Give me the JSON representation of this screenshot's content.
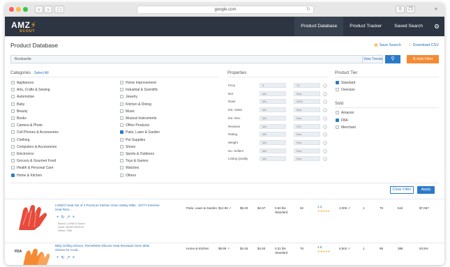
{
  "browser": {
    "url": "google.com"
  },
  "app": {
    "logo": "AMZ",
    "logo_sub": "SCOUT",
    "nav": [
      "Product Database",
      "Product Tracker",
      "Saved Search"
    ]
  },
  "page": {
    "title": "Product Database",
    "save_search": "Save Search",
    "download_csv": "Download CSV",
    "search_value": "Bookselle",
    "view_trends": "View Trends",
    "add_filter": "Add Filter"
  },
  "categories": {
    "title": "Categories",
    "select_all": "Select All",
    "col1": [
      {
        "label": "Appliances",
        "checked": false
      },
      {
        "label": "Arts, Crafts & Sewing",
        "checked": false
      },
      {
        "label": "Automotive",
        "checked": false
      },
      {
        "label": "Baby",
        "checked": false
      },
      {
        "label": "Beauty",
        "checked": false
      },
      {
        "label": "Books",
        "checked": false
      },
      {
        "label": "Camera & Photo",
        "checked": false
      },
      {
        "label": "Cell Phones & Accessories",
        "checked": false
      },
      {
        "label": "Clothing",
        "checked": false
      },
      {
        "label": "Computers & Accessories",
        "checked": false
      },
      {
        "label": "Electronics",
        "checked": false
      },
      {
        "label": "Grocery & Gourmet Food",
        "checked": false
      },
      {
        "label": "Health & Personal Care",
        "checked": false
      },
      {
        "label": "Home & Kitchen",
        "checked": true
      }
    ],
    "col2": [
      {
        "label": "Home Improvement",
        "checked": false
      },
      {
        "label": "Industrial & Scientific",
        "checked": false
      },
      {
        "label": "Jewelry",
        "checked": false
      },
      {
        "label": "Kitchen & Dining",
        "checked": false
      },
      {
        "label": "Music",
        "checked": false
      },
      {
        "label": "Musical Instruments",
        "checked": false
      },
      {
        "label": "Office Products",
        "checked": false
      },
      {
        "label": "Patio, Lawn & Garden",
        "checked": true
      },
      {
        "label": "Pet Supplies",
        "checked": false
      },
      {
        "label": "Shoes",
        "checked": false
      },
      {
        "label": "Sports & Outdoors",
        "checked": false
      },
      {
        "label": "Toys & Games",
        "checked": false
      },
      {
        "label": "Watches",
        "checked": false
      },
      {
        "label": "Others",
        "checked": false
      }
    ]
  },
  "properties": {
    "title": "Properties",
    "rows": [
      {
        "label": "Price",
        "min": "5",
        "max": "75"
      },
      {
        "label": "Net",
        "min": "Min",
        "max": "Max"
      },
      {
        "label": "Rank",
        "min": "Min",
        "max": "5000"
      },
      {
        "label": "Est. Sales",
        "min": "Min",
        "max": "Max"
      },
      {
        "label": "Est. Rev.",
        "min": "Min",
        "max": "Max"
      },
      {
        "label": "Reviews",
        "min": "Min",
        "max": "200"
      },
      {
        "label": "Rating",
        "min": "Min",
        "max": "Max"
      },
      {
        "label": "Weight",
        "min": "Min",
        "max": "Max"
      },
      {
        "label": "No. Sellers",
        "min": "Min",
        "max": "Max"
      },
      {
        "label": "Listing Quality",
        "min": "Min",
        "max": "Max"
      }
    ]
  },
  "product_tier": {
    "title": "Product Tier",
    "items": [
      {
        "label": "Standard",
        "checked": true
      },
      {
        "label": "Oversize",
        "checked": false
      }
    ]
  },
  "sold": {
    "title": "Sold",
    "items": [
      {
        "label": "Amazon",
        "checked": false
      },
      {
        "label": "FBA",
        "checked": true
      },
      {
        "label": "Merchant",
        "checked": false
      }
    ]
  },
  "buttons": {
    "clear_filter": "Clear Filter",
    "apply": "Apply"
  },
  "products": [
    {
      "title": "LONKO Heat Set of 2 Premium Kitchen Oven Safety Mitts - EGTY Extreme Heat Resi...",
      "brand": "Brand: LONKO Home",
      "asin": "ASIN: B00NTREE2S",
      "fba": "Seller: FBA",
      "category": "Patio, Lawn & Garden",
      "price": "$12.99",
      "fee1": "$5.00",
      "net": "$2.67",
      "size": "0.50 lbs",
      "tier": "Standard",
      "rank": "62",
      "rating": "4.3",
      "reviews": "2,005",
      "sellers": "1",
      "lq": "79",
      "sales": "544",
      "revenue": "$7,067"
    },
    {
      "title": "BBQ Grilling Gloves, FMAWWW Silicone Heat Resistant Oven Mitts Gloves for Cook...",
      "brand": "",
      "asin": "",
      "fba": "",
      "category": "Home & Kitchen",
      "price": "$9.99",
      "fee1": "$4.45",
      "net": "$4.93",
      "size": "0.31 lbs",
      "tier": "Standard",
      "rank": "76",
      "rating": "4.8",
      "reviews": "5,504",
      "sellers": "1",
      "lq": "98",
      "sales": "388",
      "revenue": "63.8%"
    }
  ]
}
